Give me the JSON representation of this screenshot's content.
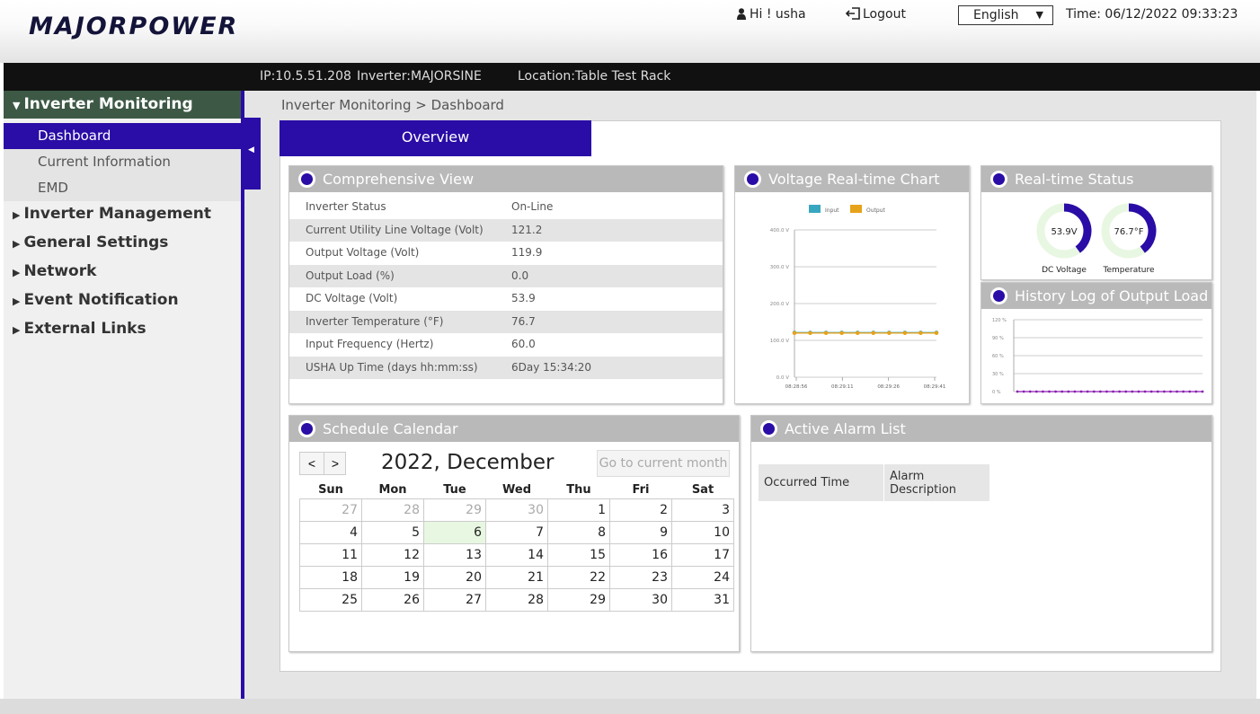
{
  "header": {
    "logo": "MAJORPOWER",
    "greeting": "Hi ! usha",
    "logout": "Logout",
    "language": "English",
    "time": "Time: 06/12/2022 09:33:23"
  },
  "infobar": {
    "ip": "IP:10.5.51.208",
    "inverter": "Inverter:MAJORSINE",
    "location": "Location:Table Test Rack"
  },
  "sidebar": {
    "sections": [
      {
        "label": "Inverter Monitoring",
        "expanded": true
      },
      {
        "label": "Inverter Management"
      },
      {
        "label": "General Settings"
      },
      {
        "label": "Network"
      },
      {
        "label": "Event Notification"
      },
      {
        "label": "External Links"
      }
    ],
    "subitems": [
      "Dashboard",
      "Current Information",
      "EMD"
    ]
  },
  "breadcrumb": "Inverter Monitoring > Dashboard",
  "tab": "Overview",
  "comprehensive": {
    "title": "Comprehensive View",
    "rows": [
      {
        "key": "Inverter Status",
        "value": "On-Line"
      },
      {
        "key": "Current Utility Line Voltage (Volt)",
        "value": "121.2"
      },
      {
        "key": "Output Voltage (Volt)",
        "value": "119.9"
      },
      {
        "key": "Output Load (%)",
        "value": "0.0"
      },
      {
        "key": "DC Voltage (Volt)",
        "value": "53.9"
      },
      {
        "key": "Inverter Temperature (°F)",
        "value": "76.7"
      },
      {
        "key": "Input Frequency (Hertz)",
        "value": "60.0"
      },
      {
        "key": "USHA Up Time (days hh:mm:ss)",
        "value": "6Day 15:34:20"
      }
    ]
  },
  "voltage_chart": {
    "title": "Voltage Real-time Chart",
    "legend": [
      "Input",
      "Output"
    ],
    "yticks": [
      "400.0 V",
      "300.0 V",
      "200.0 V",
      "100.0 V",
      "0.0 V"
    ],
    "xticks": [
      "08:28:56",
      "08:29:11",
      "08:29:26",
      "08:29:41"
    ]
  },
  "realtime": {
    "title": "Real-time Status",
    "gauges": [
      {
        "value": "53.9V",
        "label": "DC Voltage",
        "fraction": 0.4
      },
      {
        "value": "76.7°F",
        "label": "Temperature",
        "fraction": 0.4
      }
    ],
    "color": "#2a0ca6"
  },
  "history": {
    "title": "History Log of Output Load",
    "yticks": [
      "120 %",
      "90 %",
      "60 %",
      "30 %",
      "0 %"
    ]
  },
  "calendar": {
    "title": "Schedule Calendar",
    "month": "2022, December",
    "goto": "Go to current month",
    "prev": "<",
    "next": ">",
    "weekdays": [
      "Sun",
      "Mon",
      "Tue",
      "Wed",
      "Thu",
      "Fri",
      "Sat"
    ],
    "weeks": [
      [
        "27",
        "28",
        "29",
        "30",
        "1",
        "2",
        "3"
      ],
      [
        "4",
        "5",
        "6",
        "7",
        "8",
        "9",
        "10"
      ],
      [
        "11",
        "12",
        "13",
        "14",
        "15",
        "16",
        "17"
      ],
      [
        "18",
        "19",
        "20",
        "21",
        "22",
        "23",
        "24"
      ],
      [
        "25",
        "26",
        "27",
        "28",
        "29",
        "30",
        "31"
      ]
    ]
  },
  "alarm": {
    "title": "Active Alarm List",
    "col1": "Occurred Time",
    "col2a": "Alarm",
    "col2b": "Description"
  },
  "chart_data": [
    {
      "type": "line",
      "title": "Voltage Real-time Chart",
      "x": [
        "08:28:56",
        "",
        "",
        "08:29:11",
        "",
        "",
        "08:29:26",
        "",
        "",
        "08:29:41"
      ],
      "series": [
        {
          "name": "Input",
          "values": [
            121.2,
            121.2,
            121.2,
            121.2,
            121.2,
            121.2,
            121.2,
            121.2,
            121.2,
            121.2
          ],
          "color": "#39a6c0"
        },
        {
          "name": "Output",
          "values": [
            119.9,
            119.9,
            119.9,
            119.9,
            119.9,
            119.9,
            119.9,
            119.9,
            119.9,
            119.9
          ],
          "color": "#e6a21a"
        }
      ],
      "ylim": [
        0,
        400
      ]
    },
    {
      "type": "line",
      "title": "History Log of Output Load",
      "series": [
        {
          "values": [
            0,
            0,
            0,
            0,
            0,
            0,
            0,
            0,
            0,
            0,
            0,
            0,
            0,
            0,
            0,
            0,
            0,
            0,
            0,
            0,
            0,
            0,
            0,
            0,
            0,
            0,
            0,
            0,
            0,
            0
          ],
          "color": "#8a1fb0"
        }
      ],
      "ylim": [
        0,
        120
      ]
    }
  ]
}
